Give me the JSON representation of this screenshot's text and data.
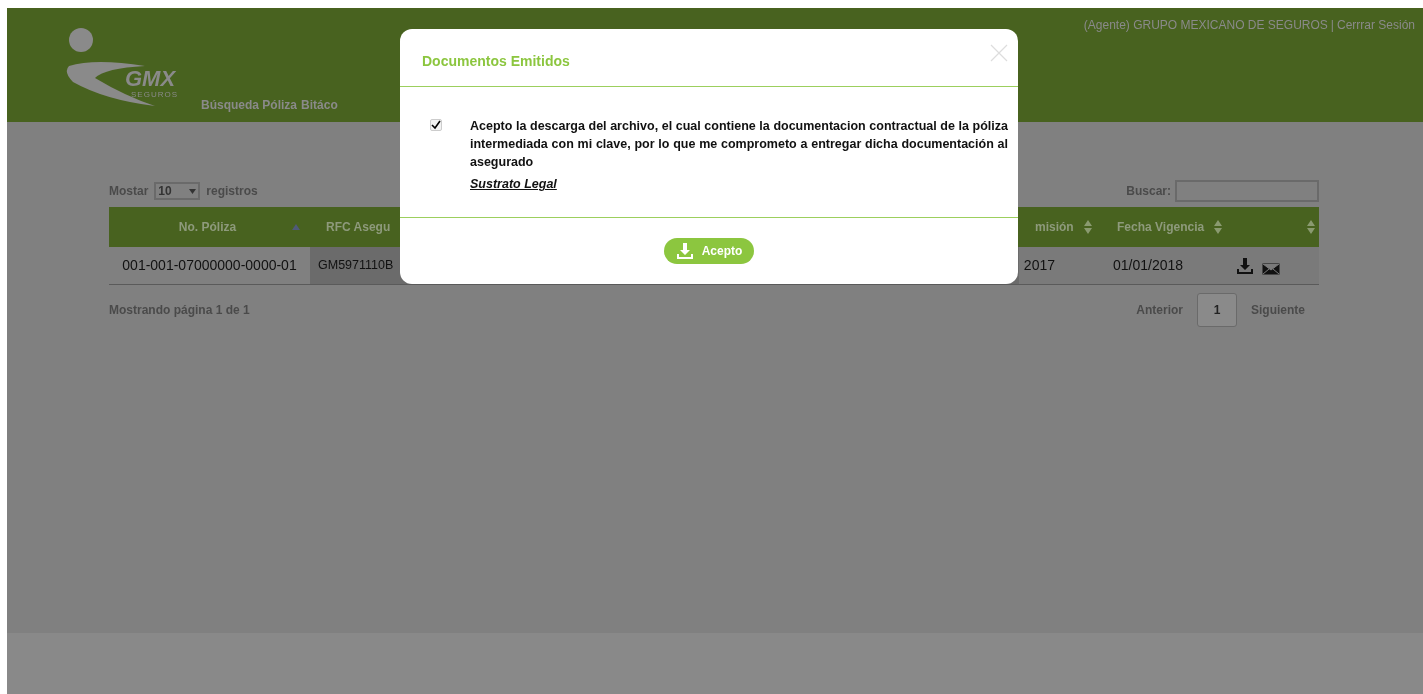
{
  "header": {
    "logo_text": "GMX",
    "logo_subtext": "SEGUROS",
    "nav": [
      "Búsqueda Póliza",
      "Bitáco"
    ],
    "user": "(Agente) GRUPO MEXICANO DE SEGUROS",
    "separator": "|",
    "logout": "Cerrrar Sesión"
  },
  "table_controls": {
    "show_label": "Mostar",
    "page_size": "10",
    "records_label": "registros",
    "search_label": "Buscar:"
  },
  "table": {
    "columns": [
      {
        "label": "No. Póliza",
        "kind": "sorted"
      },
      {
        "label": "RFC Asegu",
        "kind": "plain"
      },
      {
        "label": "misión",
        "kind": "sortable"
      },
      {
        "label": "Fecha Vigencia",
        "kind": "sortable"
      },
      {
        "kind": "sortable"
      }
    ],
    "rows": [
      {
        "cells": [
          "001-001-07000000-0000-01",
          "GM5971110B",
          "2017",
          "01/01/2018"
        ]
      }
    ]
  },
  "pagination": {
    "info": "Mostrando página 1 de 1",
    "previous": "Anterior",
    "pages": [
      {
        "label": "1",
        "selected": true
      }
    ],
    "next": "Siguiente"
  },
  "modal": {
    "title": "Documentos Emitidos",
    "checked": true,
    "text": "Acepto la descarga del archivo, el cual contiene la documentacion contractual de la póliza intermediada con mi clave, por lo que me comprometo a entregar dicha documentación al asegurado",
    "link": "Sustrato Legal",
    "button": "Acepto"
  }
}
